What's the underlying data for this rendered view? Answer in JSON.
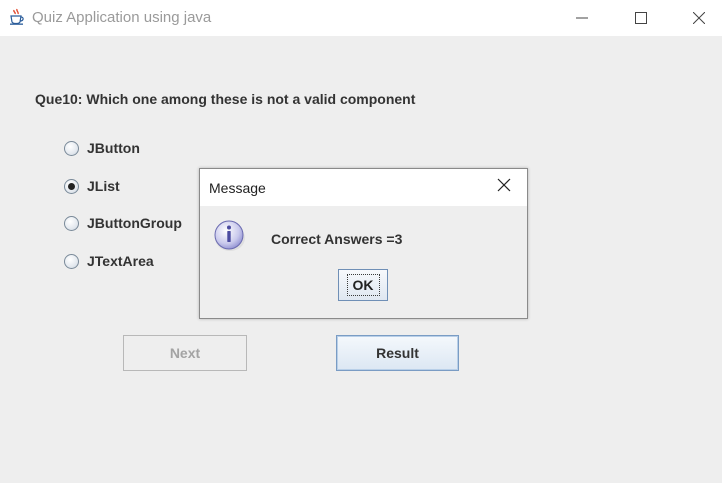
{
  "window": {
    "title": "Quiz Application using java",
    "icon": "java-coffee-cup-icon"
  },
  "quiz": {
    "question": "Que10: Which one among these is not a valid component",
    "options": [
      {
        "label": "JButton",
        "selected": false
      },
      {
        "label": "JList",
        "selected": true
      },
      {
        "label": "JButtonGroup",
        "selected": false
      },
      {
        "label": "JTextArea",
        "selected": false
      }
    ],
    "next_label": "Next",
    "next_enabled": false,
    "result_label": "Result"
  },
  "dialog": {
    "title": "Message",
    "message": "Correct Answers =3",
    "icon": "information-icon",
    "ok_label": "OK"
  },
  "colors": {
    "background": "#eeeeee",
    "titlebar": "#ffffff",
    "text": "#333333",
    "disabled_text": "#a3a3a3",
    "button_focus_border": "#7a9cc4"
  }
}
